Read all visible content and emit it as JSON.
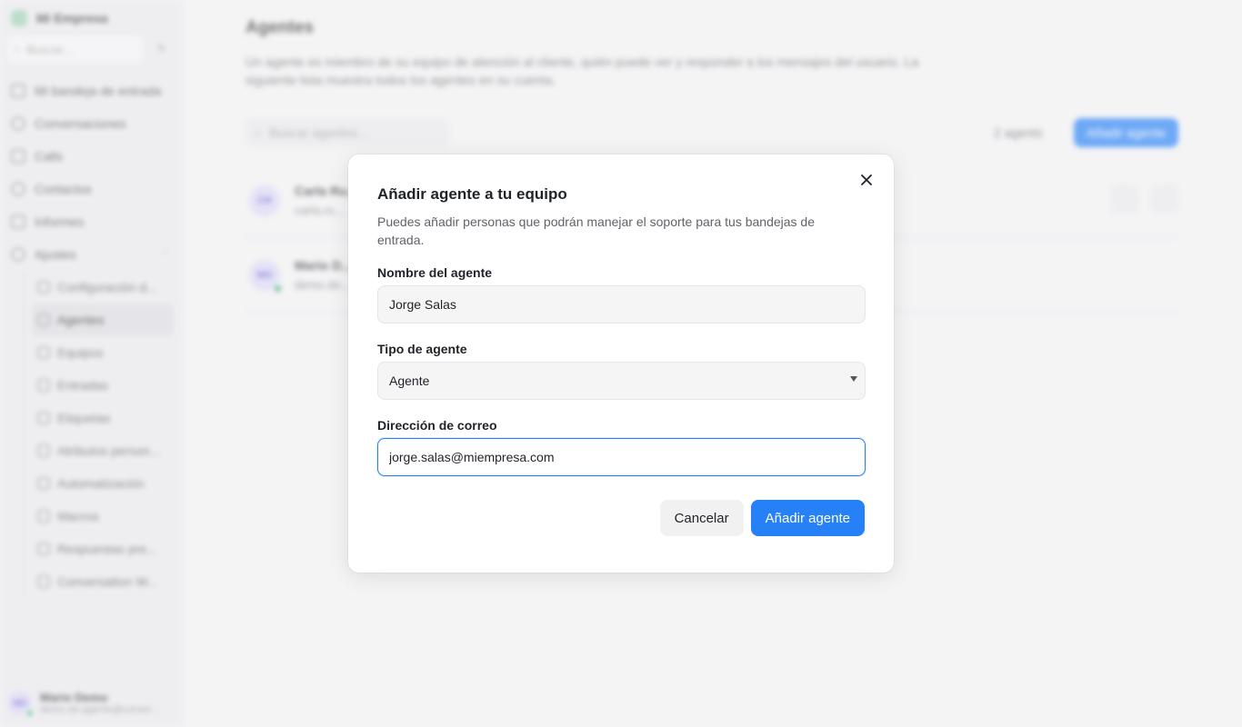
{
  "sidebar": {
    "brand": "Mi Empresa",
    "search_placeholder": "Buscar...",
    "nav": [
      {
        "label": "Mi bandeja de entrada",
        "icon": "inbox-icon"
      },
      {
        "label": "Conversaciones",
        "icon": "chat-icon"
      },
      {
        "label": "Calls",
        "icon": "phone-icon"
      },
      {
        "label": "Contactos",
        "icon": "contacts-icon"
      },
      {
        "label": "Informes",
        "icon": "reports-icon"
      },
      {
        "label": "Ajustes",
        "icon": "settings-icon"
      }
    ],
    "settings_items": [
      {
        "label": "Configuración d...",
        "icon": "config-icon"
      },
      {
        "label": "Agentes",
        "icon": "agents-icon",
        "active": true
      },
      {
        "label": "Equipos",
        "icon": "teams-icon"
      },
      {
        "label": "Entradas",
        "icon": "inbox-icon"
      },
      {
        "label": "Etiquetas",
        "icon": "tag-icon"
      },
      {
        "label": "Atributos person...",
        "icon": "attributes-icon"
      },
      {
        "label": "Automatización",
        "icon": "automation-icon"
      },
      {
        "label": "Macros",
        "icon": "macros-icon"
      },
      {
        "label": "Respuestas pre...",
        "icon": "canned-responses-icon"
      },
      {
        "label": "Conversation W...",
        "icon": "workflow-icon"
      }
    ],
    "user": {
      "initials": "MD",
      "name": "Mario Demo",
      "email": "demo.de.agente@correo..."
    }
  },
  "main": {
    "title": "Agentes",
    "description": "Un agente es miembro de su equipo de atención al cliente, quién puede ver y responder a los mensajes del usuario. La siguiente lista muestra todos los agentes en su cuenta.",
    "search_placeholder": "Buscar agentes...",
    "count": "2 agents",
    "add_button": "Añadir agente",
    "agents": [
      {
        "initials": "CR",
        "name": "Carla Ru...",
        "email": "carla.ro...",
        "online": false
      },
      {
        "initials": "MD",
        "name": "Mario D...",
        "email": "demo.de...",
        "online": true
      }
    ]
  },
  "modal": {
    "title": "Añadir agente a tu equipo",
    "description": "Puedes añadir personas que podrán manejar el soporte para tus bandejas de entrada.",
    "name_label": "Nombre del agente",
    "name_value": "Jorge Salas",
    "type_label": "Tipo de agente",
    "type_value": "Agente",
    "email_label": "Dirección de correo",
    "email_value": "jorge.salas@miempresa.com",
    "cancel_label": "Cancelar",
    "submit_label": "Añadir agente"
  },
  "colors": {
    "accent": "#2781f6",
    "online": "#22a06b",
    "avatar_bg": "#dcd9f5"
  }
}
